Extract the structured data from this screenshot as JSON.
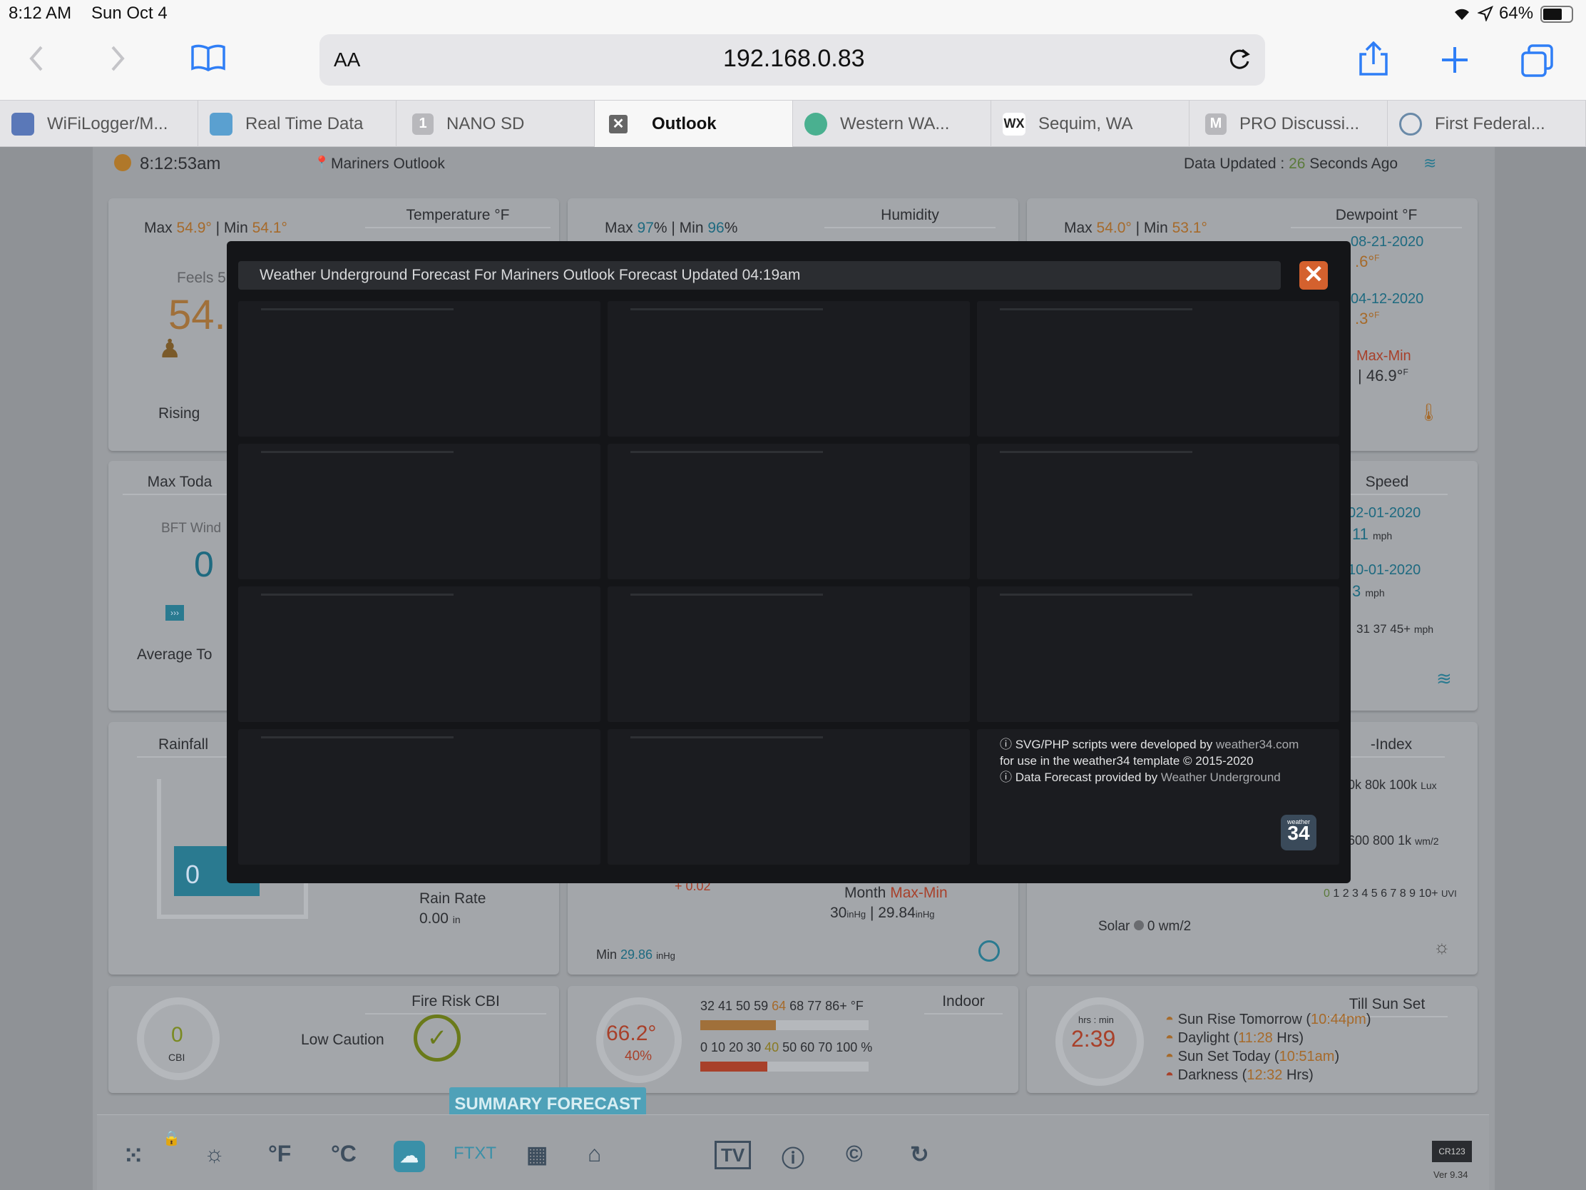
{
  "status": {
    "time": "8:12 AM",
    "date": "Sun Oct 4",
    "battery": "64%"
  },
  "browser": {
    "url": "192.168.0.83",
    "aa_label": "AA"
  },
  "tabs": [
    {
      "label": "WiFiLogger/M...",
      "color": "#5a78b8"
    },
    {
      "label": "Real Time Data",
      "color": "#5aa0d0"
    },
    {
      "label": "NANO SD",
      "glyph": "1",
      "color": "#b8b8bc"
    },
    {
      "label": "Outlook",
      "glyph": "✕",
      "color": "#666"
    },
    {
      "label": "Western WA...",
      "color": "#4ab090"
    },
    {
      "label": "Sequim, WA",
      "glyph": "WX",
      "color": "#333"
    },
    {
      "label": "PRO Discussi...",
      "glyph": "M",
      "color": "#b8b8bc"
    },
    {
      "label": "First Federal...",
      "color": "#6a8aa8"
    }
  ],
  "header": {
    "clock": "8:12:53am",
    "station": "Mariners Outlook",
    "updated_prefix": "Data Updated : ",
    "updated_num": "26",
    "updated_suffix": " Seconds Ago"
  },
  "temp": {
    "title": "Temperature °F",
    "max_label": "Max ",
    "max": "54.9°",
    "sep": " | Min ",
    "min": "54.1°",
    "feels": "Feels 5",
    "big": "54.",
    "trend": "Rising"
  },
  "humidity": {
    "title": "Humidity",
    "max_label": "Max ",
    "max": "97",
    "pct": "%",
    "sep": " | Min ",
    "min": "96",
    "pct2": "%"
  },
  "dewpoint": {
    "title": "Dewpoint °F",
    "max_label": "Max ",
    "max": "54.0°",
    "sep": " | Min ",
    "min": "53.1°",
    "d1": "08-21-2020",
    "v1": ".6°",
    "d2": "04-12-2020",
    "v2": ".3°",
    "mm_label": "Max-Min",
    "mm_val": "46.9°",
    "f": "F"
  },
  "wind": {
    "max_today": "Max Toda",
    "bft": "BFT Wind",
    "zero": "0",
    "avg": "Average To",
    "title": "Speed",
    "d1": "02-01-2020",
    "v1": "11",
    "d2": "10-01-2020",
    "v2": "3",
    "unit": "mph",
    "gusts": "31 37 45+"
  },
  "rain": {
    "title": "Rainfall",
    "zero": "0",
    "rate_label": "Rain Rate",
    "rate": "0.00",
    "rate_unit": "in"
  },
  "baro": {
    "delta": "+ 0.02",
    "month": "Month ",
    "maxmin": "Max-Min",
    "v1": "30",
    "v2": "29.84",
    "unit": "inHg",
    "sep": " | ",
    "min_label": "Min ",
    "min": "29.86"
  },
  "uv": {
    "title": "-Index",
    "lux": "0k 80k 100k",
    "lux_unit": "Lux",
    "wm": "600 800 1k",
    "wm_unit": "wm/2",
    "scale_zero": "0",
    "scale": "1 2 3 4 5 6 7 8 9 10+",
    "uvi": "UVI",
    "solar": "Solar",
    "solar_val": "0 wm/2"
  },
  "fire": {
    "title": "Fire Risk CBI",
    "value": "0",
    "unit": "CBI",
    "level": "Low Caution"
  },
  "indoor": {
    "title": "Indoor",
    "temp": "66.2°",
    "hum": "40%",
    "tscale_a": "32 41 50 59 ",
    "tscale_b": "64",
    "tscale_c": " 68 77 86+ °F",
    "hscale_a": "0 10 20 30 ",
    "hscale_b": "40",
    "hscale_c": " 50 60 70 100 %",
    "temp_fill": 0.45,
    "hum_fill": 0.4
  },
  "sun": {
    "title": "Till Sun Set",
    "hrs": "hrs : min",
    "time": "2:39",
    "rise_label": "Sun Rise Tomorrow (",
    "rise": "10:44pm",
    "daylight_label": "Daylight (",
    "daylight": "11:28",
    "daylight_suffix": " Hrs)",
    "set_label": "Sun Set Today (",
    "set": "10:51am",
    "dark_label": "Darkness (",
    "dark": "12:32",
    "close": ")"
  },
  "modal": {
    "title": "Weather Underground Forecast For Mariners Outlook Forecast Updated 04:19am",
    "close": "✕",
    "credit1_prefix": "ⓘ SVG/PHP scripts were developed by ",
    "credit1_link": "weather34.com",
    "credit2": "for use in the weather34 template © 2015-2020",
    "credit3_prefix": "ⓘ Data Forecast provided by ",
    "credit3_link": "Weather Underground",
    "logo_small": "weather",
    "logo": "34"
  },
  "dock": {
    "summary": "SUMMARY FORECAST",
    "f": "°F",
    "c": "°C",
    "ftxt": "FTXT",
    "tv": "TV",
    "version": "Ver 9.34",
    "cr": "CR123"
  },
  "colors": {
    "accent": "#d4612e",
    "teal": "#4fa1b8",
    "orange": "#a66a2a"
  }
}
